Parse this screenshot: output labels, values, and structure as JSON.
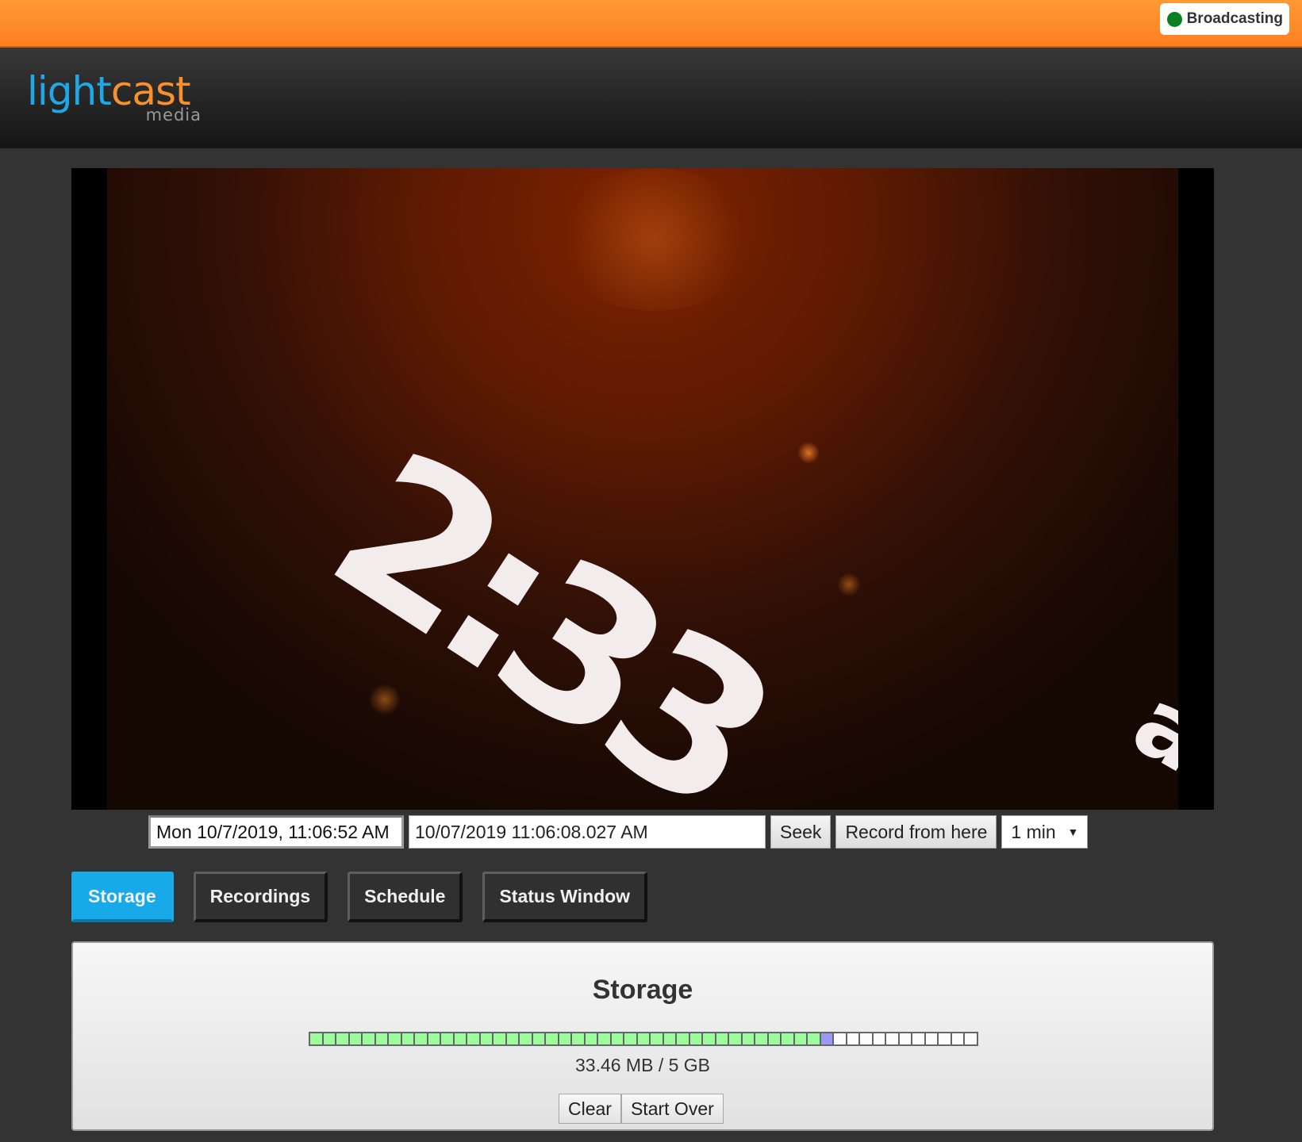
{
  "status": {
    "label": "Broadcasting",
    "color": "#0a8020"
  },
  "brand": {
    "part1": "light",
    "part2": "cast",
    "sub": "media",
    "color1": "#1fa8e6",
    "color2": "#f7912d"
  },
  "video": {
    "frame_text": "2:33",
    "edge_text": "a"
  },
  "controls": {
    "current_time": "Mon 10/7/2019, 11:06:52 AM",
    "seek_value": "10/07/2019 11:06:08.027  AM",
    "seek_label": "Seek",
    "record_label": "Record from here",
    "duration_selected": "1 min"
  },
  "tabs": [
    {
      "label": "Storage",
      "active": true
    },
    {
      "label": "Recordings",
      "active": false
    },
    {
      "label": "Schedule",
      "active": false
    },
    {
      "label": "Status Window",
      "active": false
    }
  ],
  "storage": {
    "title": "Storage",
    "used_cells": 39,
    "current_cells": 1,
    "free_cells": 11,
    "usage_text": "33.46 MB / 5 GB",
    "clear_label": "Clear",
    "start_over_label": "Start Over",
    "colors": {
      "used": "#9cfc9c",
      "current": "#9a9af6",
      "free": "#fcfcfc"
    }
  }
}
